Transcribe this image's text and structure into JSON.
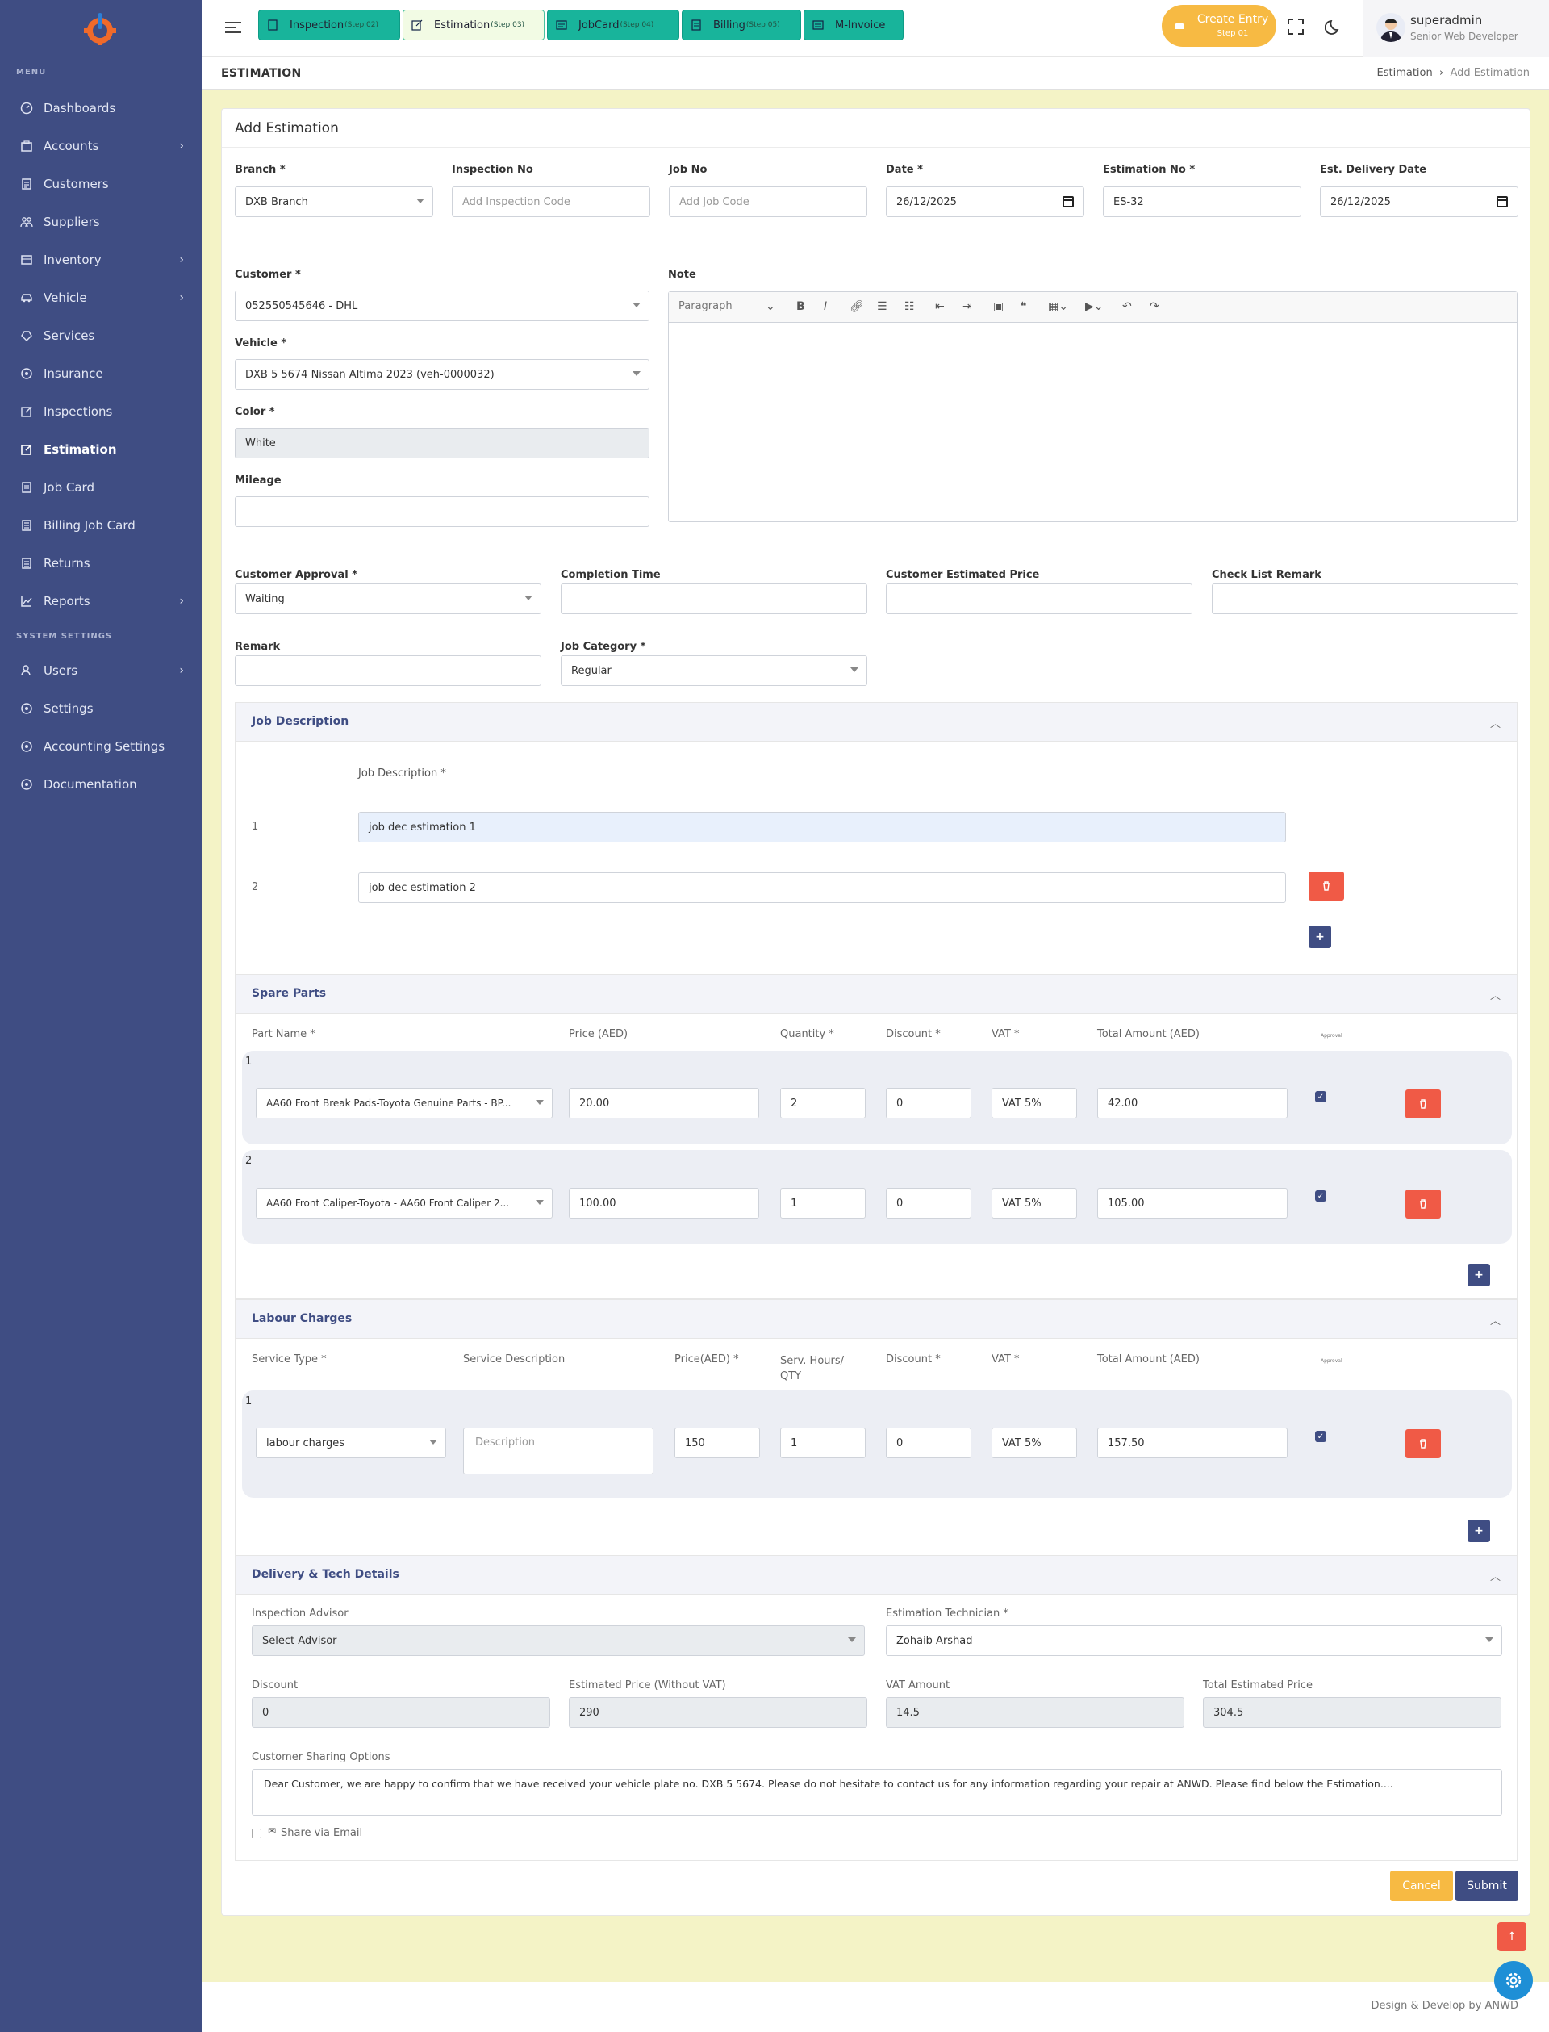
{
  "sidebar": {
    "menu_title": "MENU",
    "system_title": "SYSTEM SETTINGS",
    "items": [
      {
        "label": "Dashboards",
        "icon": "dashboard-icon"
      },
      {
        "label": "Accounts",
        "icon": "building-icon"
      },
      {
        "label": "Customers",
        "icon": "customer-card-icon"
      },
      {
        "label": "Suppliers",
        "icon": "suppliers-icon"
      },
      {
        "label": "Inventory",
        "icon": "inventory-icon"
      },
      {
        "label": "Vehicle",
        "icon": "car-icon"
      },
      {
        "label": "Services",
        "icon": "services-icon"
      },
      {
        "label": "Insurance",
        "icon": "insurance-icon"
      },
      {
        "label": "Inspections",
        "icon": "inspection-icon"
      },
      {
        "label": "Estimation",
        "icon": "estimation-icon"
      },
      {
        "label": "Job Card",
        "icon": "job-card-icon"
      },
      {
        "label": "Billing Job Card",
        "icon": "billing-icon"
      },
      {
        "label": "Returns",
        "icon": "returns-icon"
      },
      {
        "label": "Reports",
        "icon": "reports-icon"
      },
      {
        "label": "Users",
        "icon": "users-icon"
      },
      {
        "label": "Settings",
        "icon": "settings-icon"
      },
      {
        "label": "Accounting Settings",
        "icon": "accounting-settings-icon"
      },
      {
        "label": "Documentation",
        "icon": "documentation-icon"
      }
    ]
  },
  "topbar": {
    "steps": [
      {
        "label": "Inspection",
        "sub": "(Step 02)"
      },
      {
        "label": "Estimation",
        "sub": "(Step 03)"
      },
      {
        "label": "JobCard",
        "sub": "(Step 04)"
      },
      {
        "label": "Billing",
        "sub": "(Step 05)"
      },
      {
        "label": "M-Invoice",
        "sub": ""
      }
    ],
    "create_entry": "Create Entry",
    "create_step": "Step 01",
    "user_name": "superadmin",
    "user_role": "Senior Web Developer"
  },
  "page": {
    "title": "ESTIMATION",
    "breadcrumb": [
      "Estimation",
      "Add Estimation"
    ],
    "card_title": "Add Estimation"
  },
  "form": {
    "branch": {
      "label": "Branch *",
      "value": "DXB Branch"
    },
    "inspection_no": {
      "label": "Inspection No",
      "placeholder": "Add Inspection Code"
    },
    "job_no": {
      "label": "Job No",
      "placeholder": "Add Job Code"
    },
    "date": {
      "label": "Date *",
      "value": "26/12/2025"
    },
    "estimation_no": {
      "label": "Estimation No *",
      "value": "ES-32"
    },
    "delivery_date": {
      "label": "Est. Delivery Date",
      "value": "26/12/2025"
    },
    "customer": {
      "label": "Customer *",
      "value": "052550545646 - DHL"
    },
    "vehicle": {
      "label": "Vehicle *",
      "value": "DXB 5 5674 Nissan Altima 2023 (veh-0000032)"
    },
    "color": {
      "label": "Color *",
      "value": "White"
    },
    "mileage": {
      "label": "Mileage",
      "value": ""
    },
    "note": {
      "label": "Note",
      "toolbar_paragraph": "Paragraph"
    },
    "customer_approval": {
      "label": "Customer Approval *",
      "value": "Waiting"
    },
    "completion_time": {
      "label": "Completion Time",
      "value": ""
    },
    "customer_estimated_price": {
      "label": "Customer Estimated Price",
      "value": ""
    },
    "checklist_remark": {
      "label": "Check List Remark",
      "value": ""
    },
    "remark": {
      "label": "Remark",
      "value": ""
    },
    "job_category": {
      "label": "Job Category *",
      "value": "Regular"
    }
  },
  "job_description": {
    "title": "Job Description",
    "column": "Job Description *",
    "rows": [
      {
        "no": "1",
        "value": "job dec estimation 1"
      },
      {
        "no": "2",
        "value": "job dec estimation 2"
      }
    ]
  },
  "spare_parts": {
    "title": "Spare Parts",
    "columns": [
      "Part Name *",
      "Price (AED)",
      "Quantity *",
      "Discount *",
      "VAT *",
      "Total Amount (AED)",
      "Approval"
    ],
    "rows": [
      {
        "no": "1",
        "part": "AA60 Front Break Pads-Toyota Genuine Parts - BP...",
        "price": "20.00",
        "qty": "2",
        "discount": "0",
        "vat": "VAT 5%",
        "total": "42.00"
      },
      {
        "no": "2",
        "part": "AA60 Front Caliper-Toyota - AA60 Front Caliper 2...",
        "price": "100.00",
        "qty": "1",
        "discount": "0",
        "vat": "VAT 5%",
        "total": "105.00"
      }
    ]
  },
  "labour": {
    "title": "Labour Charges",
    "columns": [
      "Service Type *",
      "Service Description",
      "Price(AED) *",
      "Serv. Hours/ QTY",
      "Discount *",
      "VAT *",
      "Total Amount (AED)",
      "Approval"
    ],
    "rows": [
      {
        "no": "1",
        "type": "labour charges",
        "desc_placeholder": "Description",
        "price": "150",
        "qty": "1",
        "discount": "0",
        "vat": "VAT 5%",
        "total": "157.50"
      }
    ]
  },
  "delivery": {
    "title": "Delivery & Tech Details",
    "advisor": {
      "label": "Inspection Advisor",
      "value": "Select Advisor"
    },
    "technician": {
      "label": "Estimation Technician *",
      "value": "Zohaib Arshad"
    },
    "discount": {
      "label": "Discount",
      "value": "0"
    },
    "est_price": {
      "label": "Estimated Price (Without VAT)",
      "value": "290"
    },
    "vat_amount": {
      "label": "VAT Amount",
      "value": "14.5"
    },
    "total_price": {
      "label": "Total Estimated Price",
      "value": "304.5"
    },
    "sharing": {
      "label": "Customer Sharing Options",
      "value": "Dear Customer, we are happy to confirm that we have received your vehicle plate no. DXB 5 5674. Please do not hesitate to contact us for any information regarding your repair at ANWD. Please find below the Estimation...."
    },
    "share_email": "Share via Email"
  },
  "actions": {
    "cancel": "Cancel",
    "submit": "Submit"
  },
  "footer": "Design & Develop by ANWD",
  "colors": {
    "sidebar": "#3f4d83",
    "step": "#18b49b",
    "create": "#f7ba43",
    "danger": "#f05a46",
    "background": "#f4f3c6"
  }
}
